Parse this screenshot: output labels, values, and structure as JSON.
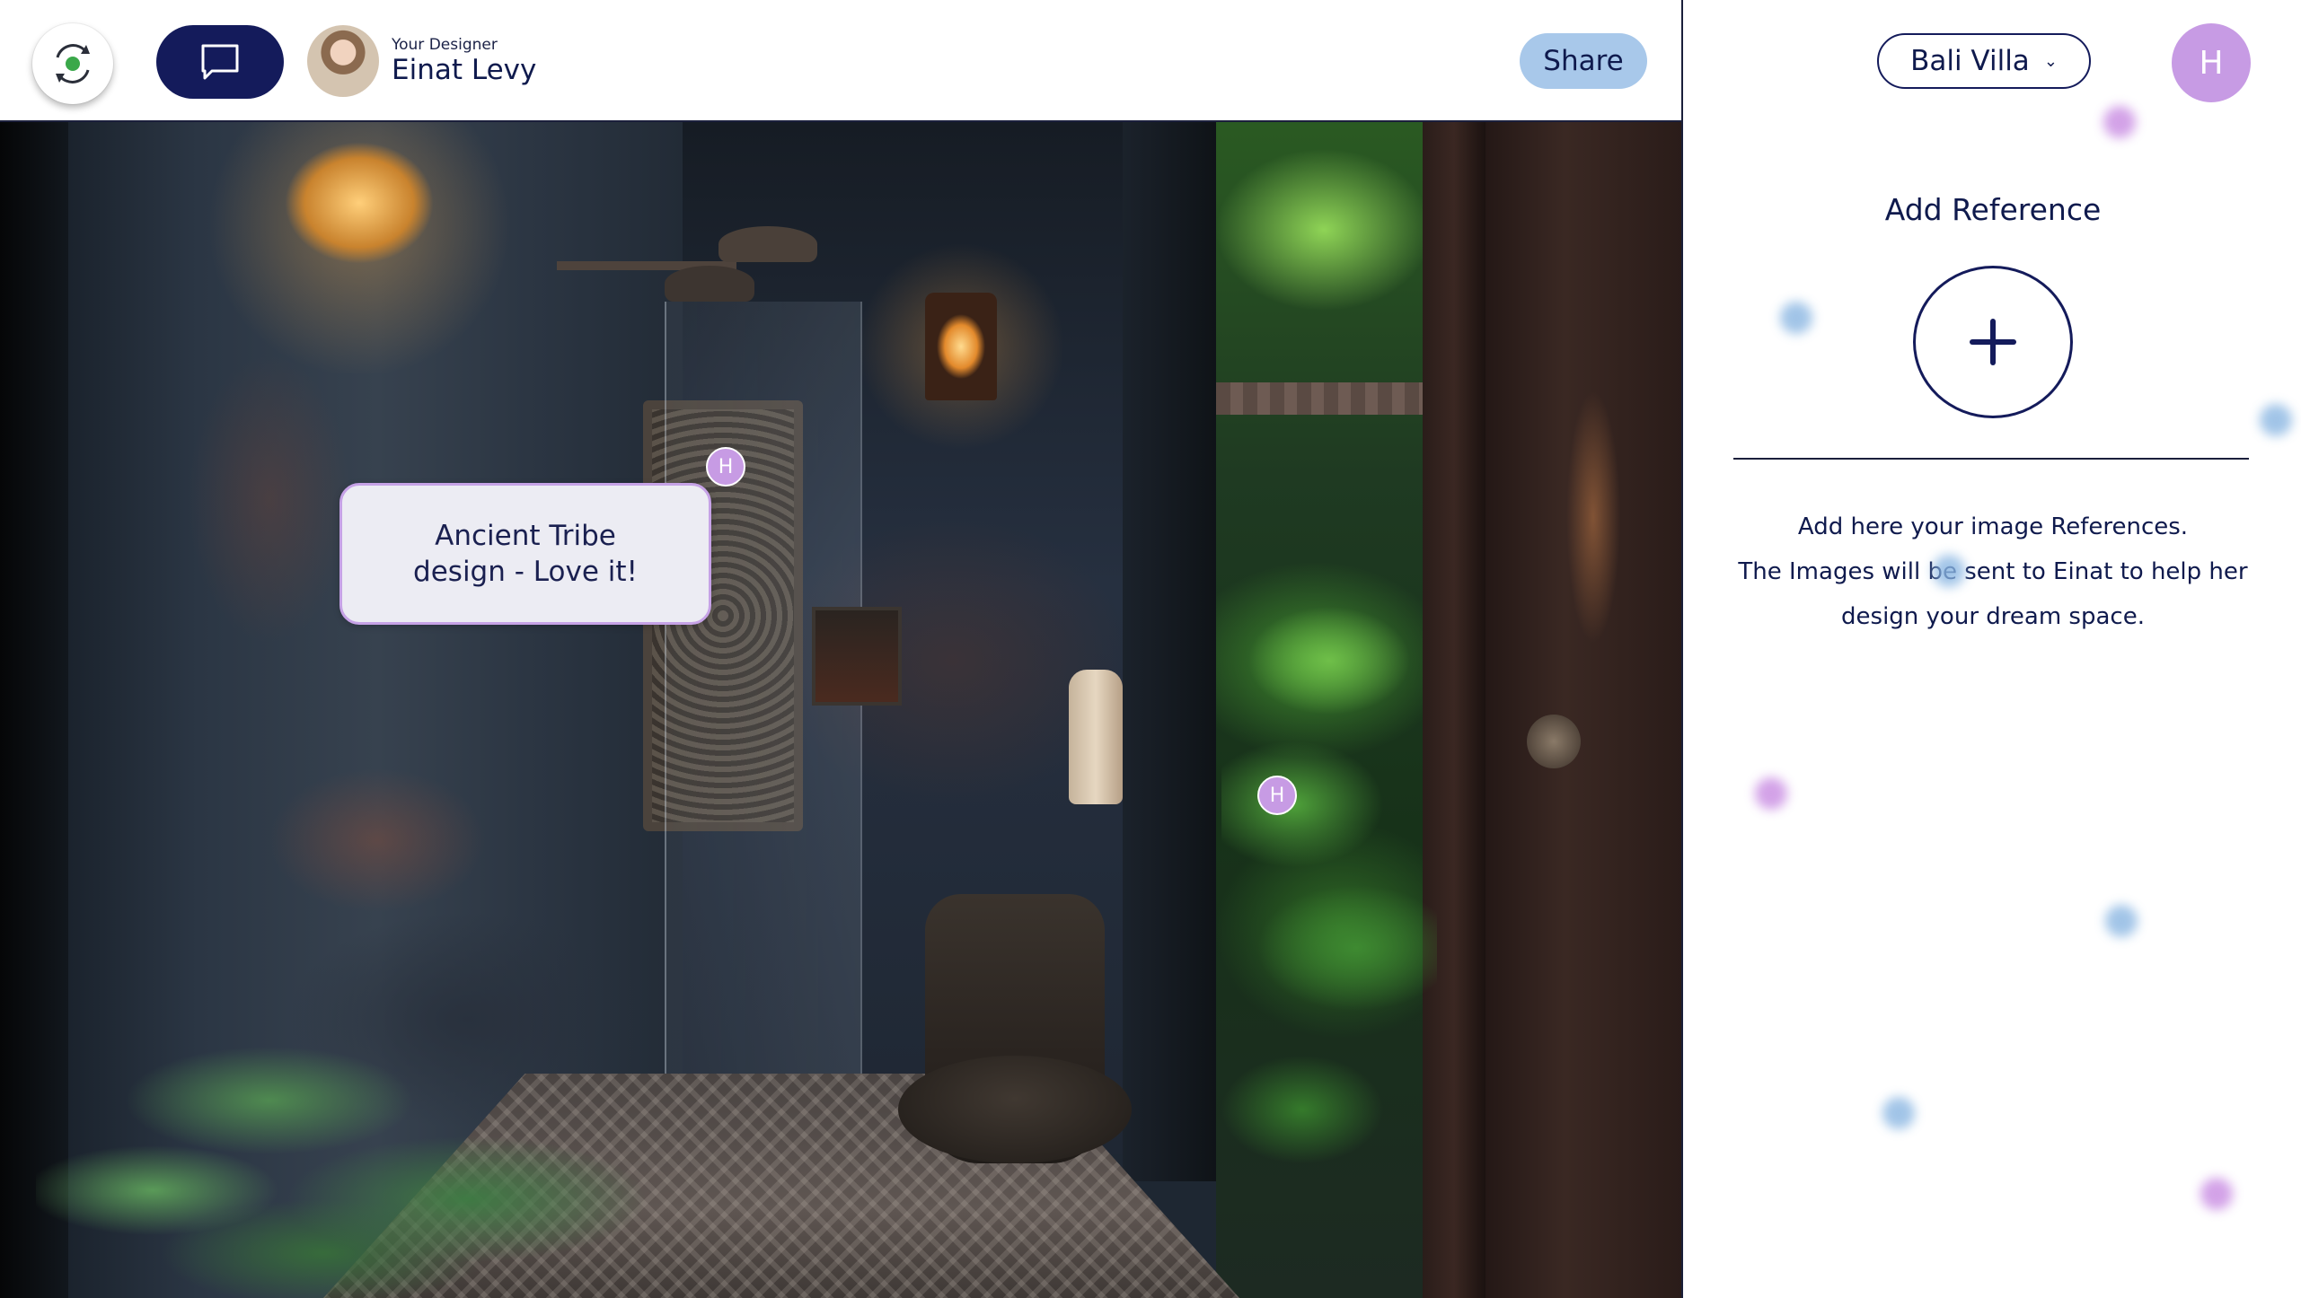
{
  "header": {
    "designer_label": "Your Designer",
    "designer_name": "Einat Levy",
    "share_label": "Share"
  },
  "icons": {
    "logo": "sync-logo-icon",
    "chat": "chat-bubble-icon",
    "add": "plus-icon",
    "dropdown": "chevron-down-icon"
  },
  "annotations": {
    "pin_1_initial": "H",
    "pin_2_initial": "H",
    "comment": "Ancient Tribe design - Love it!"
  },
  "right_panel": {
    "project_name": "Bali Villa",
    "user_initial": "H",
    "title": "Add Reference",
    "help_line_1": "Add here your image References.",
    "help_line_2": "The Images will be sent to Einat to help her",
    "help_line_3": "design your dream space."
  },
  "colors": {
    "navy": "#141b5b",
    "share_button": "#a8c8ea",
    "avatar_purple": "#c79be4",
    "logo_green": "#3aa84a"
  }
}
